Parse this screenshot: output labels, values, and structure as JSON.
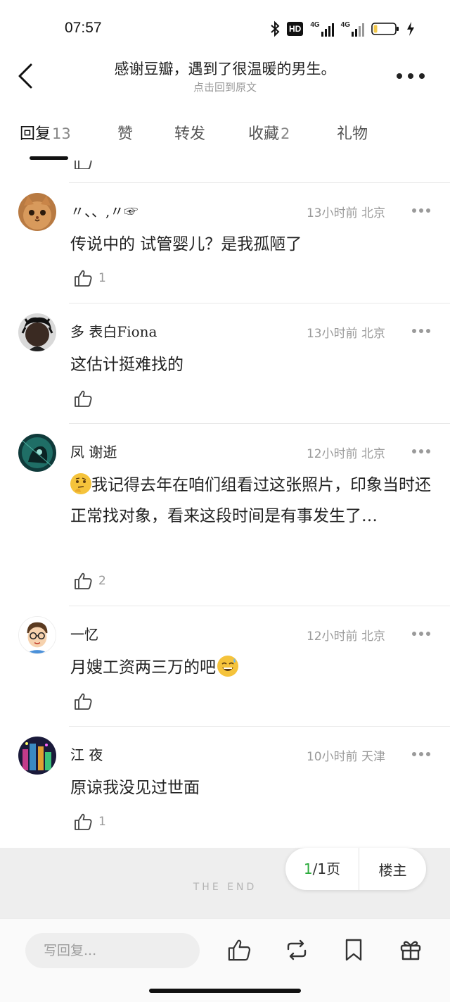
{
  "status_bar": {
    "time": "07:57",
    "icons": [
      "bluetooth-icon",
      "hd-voice-icon",
      "signal-4g-icon",
      "signal-4g-icon",
      "battery-low-icon",
      "charging-icon"
    ],
    "hd_label": "HD",
    "network_label": "4G"
  },
  "nav": {
    "title": "感谢豆瓣，遇到了很温暖的男生。",
    "subtitle": "点击回到原文"
  },
  "tabs": [
    {
      "label": "回复",
      "count": "13",
      "active": true
    },
    {
      "label": "赞",
      "count": ""
    },
    {
      "label": "转发",
      "count": ""
    },
    {
      "label": "收藏",
      "count": "2"
    },
    {
      "label": "礼物",
      "count": ""
    }
  ],
  "comments": [
    {
      "username": "〃、、,〃☞",
      "meta": "13小时前 北京",
      "text": "传说中的 试管婴儿？是我孤陋了",
      "likes": "1",
      "avatar": "cat-avatar"
    },
    {
      "username": "多  表白Fiona",
      "meta": "13小时前 北京",
      "text": "这估计挺难找的",
      "likes": "",
      "avatar": "man-avatar"
    },
    {
      "username": "凤 谢逝",
      "meta": "12小时前 北京",
      "text": "我记得去年在咱们组看过这张照片，印象当时还正常找对象，看来这段时间是有事发生了…",
      "text_emoji": "thinking-face-emoji",
      "likes": "2",
      "avatar": "anime-avatar"
    },
    {
      "username": "一忆",
      "meta": "12小时前 北京",
      "text": "月嫂工资两三万的吧",
      "text_emoji_after": "grinning-sweat-emoji",
      "likes": "",
      "avatar": "cartoon-glasses-avatar"
    },
    {
      "username": "江 夜",
      "meta": "10小时前 天津",
      "text": "原谅我没见过世面",
      "likes": "1",
      "avatar": "city-night-avatar"
    }
  ],
  "footer": {
    "page_current": "1",
    "page_rest": "/1页",
    "op_label": "楼主",
    "the_end": "THE END"
  },
  "bottom_bar": {
    "reply_placeholder": "写回复...",
    "actions": [
      "thumbs-up-icon",
      "repost-icon",
      "bookmark-icon",
      "gift-icon"
    ]
  },
  "colors": {
    "accent_green": "#2bab3c",
    "meta_gray": "#9a9a9a"
  }
}
